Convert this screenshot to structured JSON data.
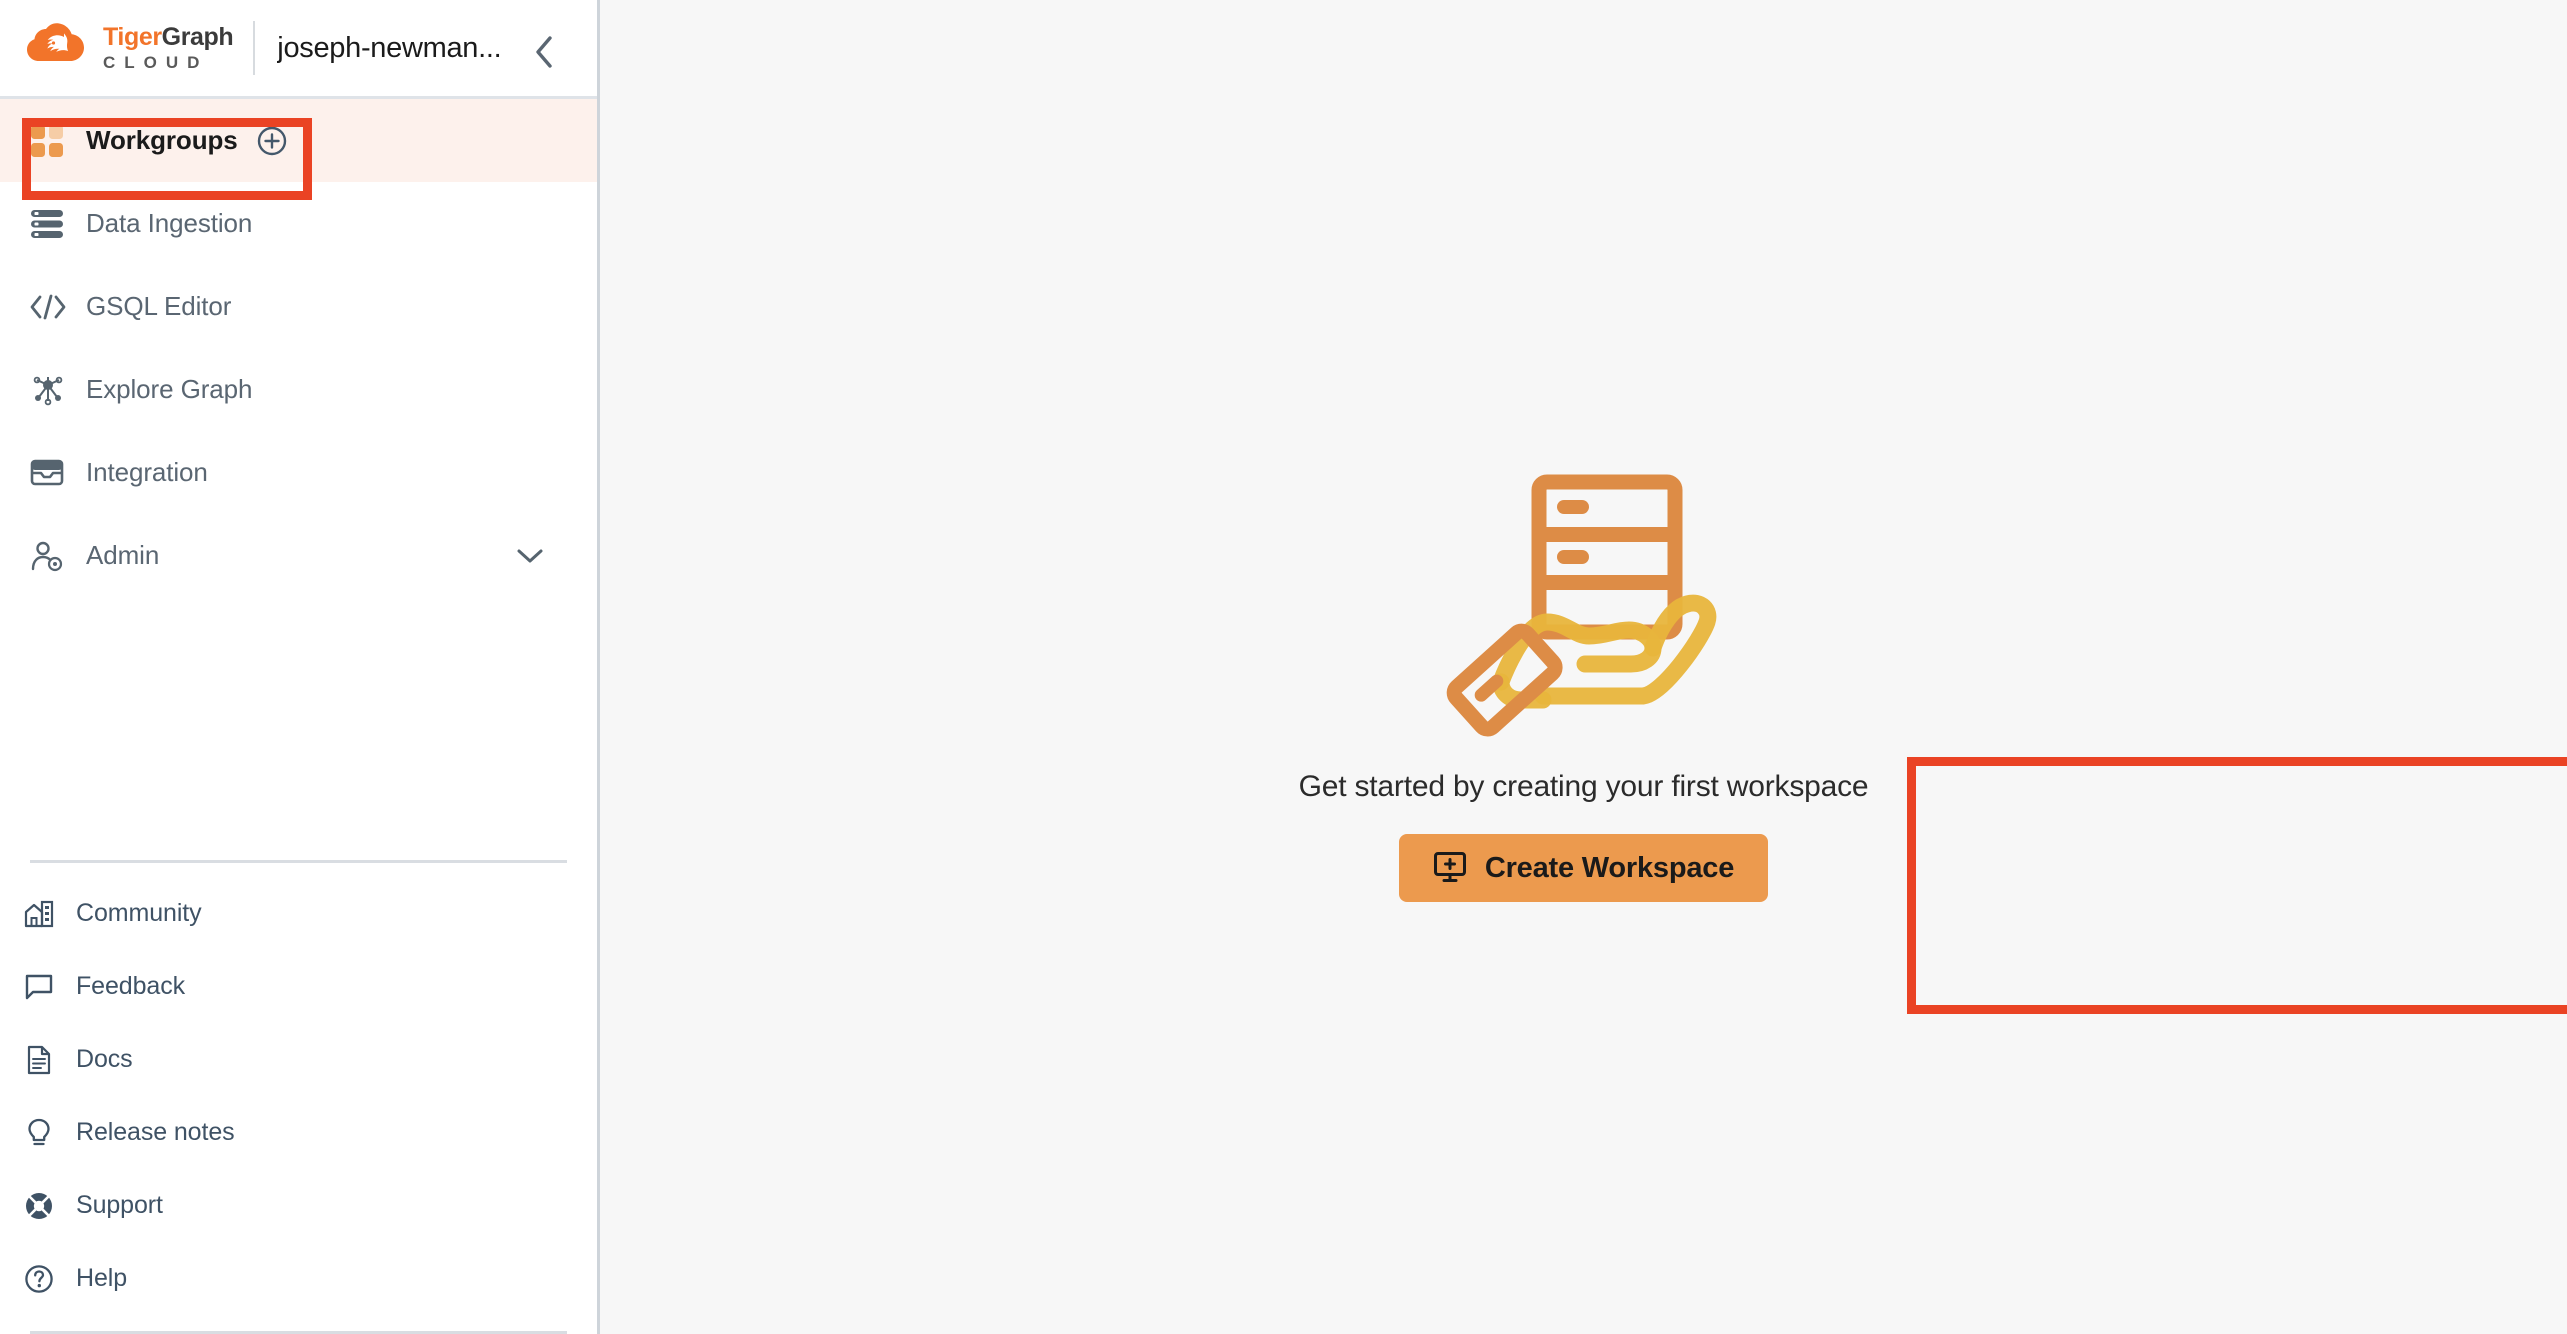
{
  "brand": {
    "logo_line1_part1": "Tiger",
    "logo_line1_part2": "Graph",
    "logo_line2": "CLOUD",
    "accent_orange": "#F2742A",
    "button_orange": "#EC9A4E",
    "annotation_red": "#EA4324",
    "active_row_bg": "#FDF1EC",
    "sidebar_text": "#5a6672",
    "footer_text": "#3f5265"
  },
  "header": {
    "account_name": "joseph-newman...",
    "collapse_icon": "chevron-left-icon"
  },
  "sidebar": {
    "primary_items": [
      {
        "label": "Workgroups",
        "icon": "grid-squares-icon",
        "active": true,
        "has_add": true,
        "add_icon": "plus-circle-icon"
      },
      {
        "label": "Data Ingestion",
        "icon": "server-stack-icon",
        "active": false
      },
      {
        "label": "GSQL Editor",
        "icon": "code-brackets-icon",
        "active": false
      },
      {
        "label": "Explore Graph",
        "icon": "graph-nodes-icon",
        "active": false
      },
      {
        "label": "Integration",
        "icon": "inbox-tray-icon",
        "active": false
      },
      {
        "label": "Admin",
        "icon": "user-gear-icon",
        "active": false,
        "has_expand": true,
        "expand_icon": "chevron-down-icon"
      }
    ],
    "secondary_items": [
      {
        "label": "Community",
        "icon": "community-building-icon"
      },
      {
        "label": "Feedback",
        "icon": "speech-bubble-icon"
      },
      {
        "label": "Docs",
        "icon": "document-icon"
      },
      {
        "label": "Release notes",
        "icon": "lightbulb-icon"
      },
      {
        "label": "Support",
        "icon": "lifebuoy-icon"
      },
      {
        "label": "Help",
        "icon": "question-circle-icon"
      }
    ]
  },
  "main": {
    "illustration_name": "hand-holding-server-illustration",
    "empty_state_text": "Get started by creating your first workspace",
    "create_button_label": "Create Workspace",
    "create_button_icon": "monitor-plus-icon"
  },
  "annotations": [
    {
      "name": "workgroups-highlight",
      "target": "Workgroups"
    },
    {
      "name": "create-workspace-highlight",
      "target": "Create Workspace"
    }
  ]
}
